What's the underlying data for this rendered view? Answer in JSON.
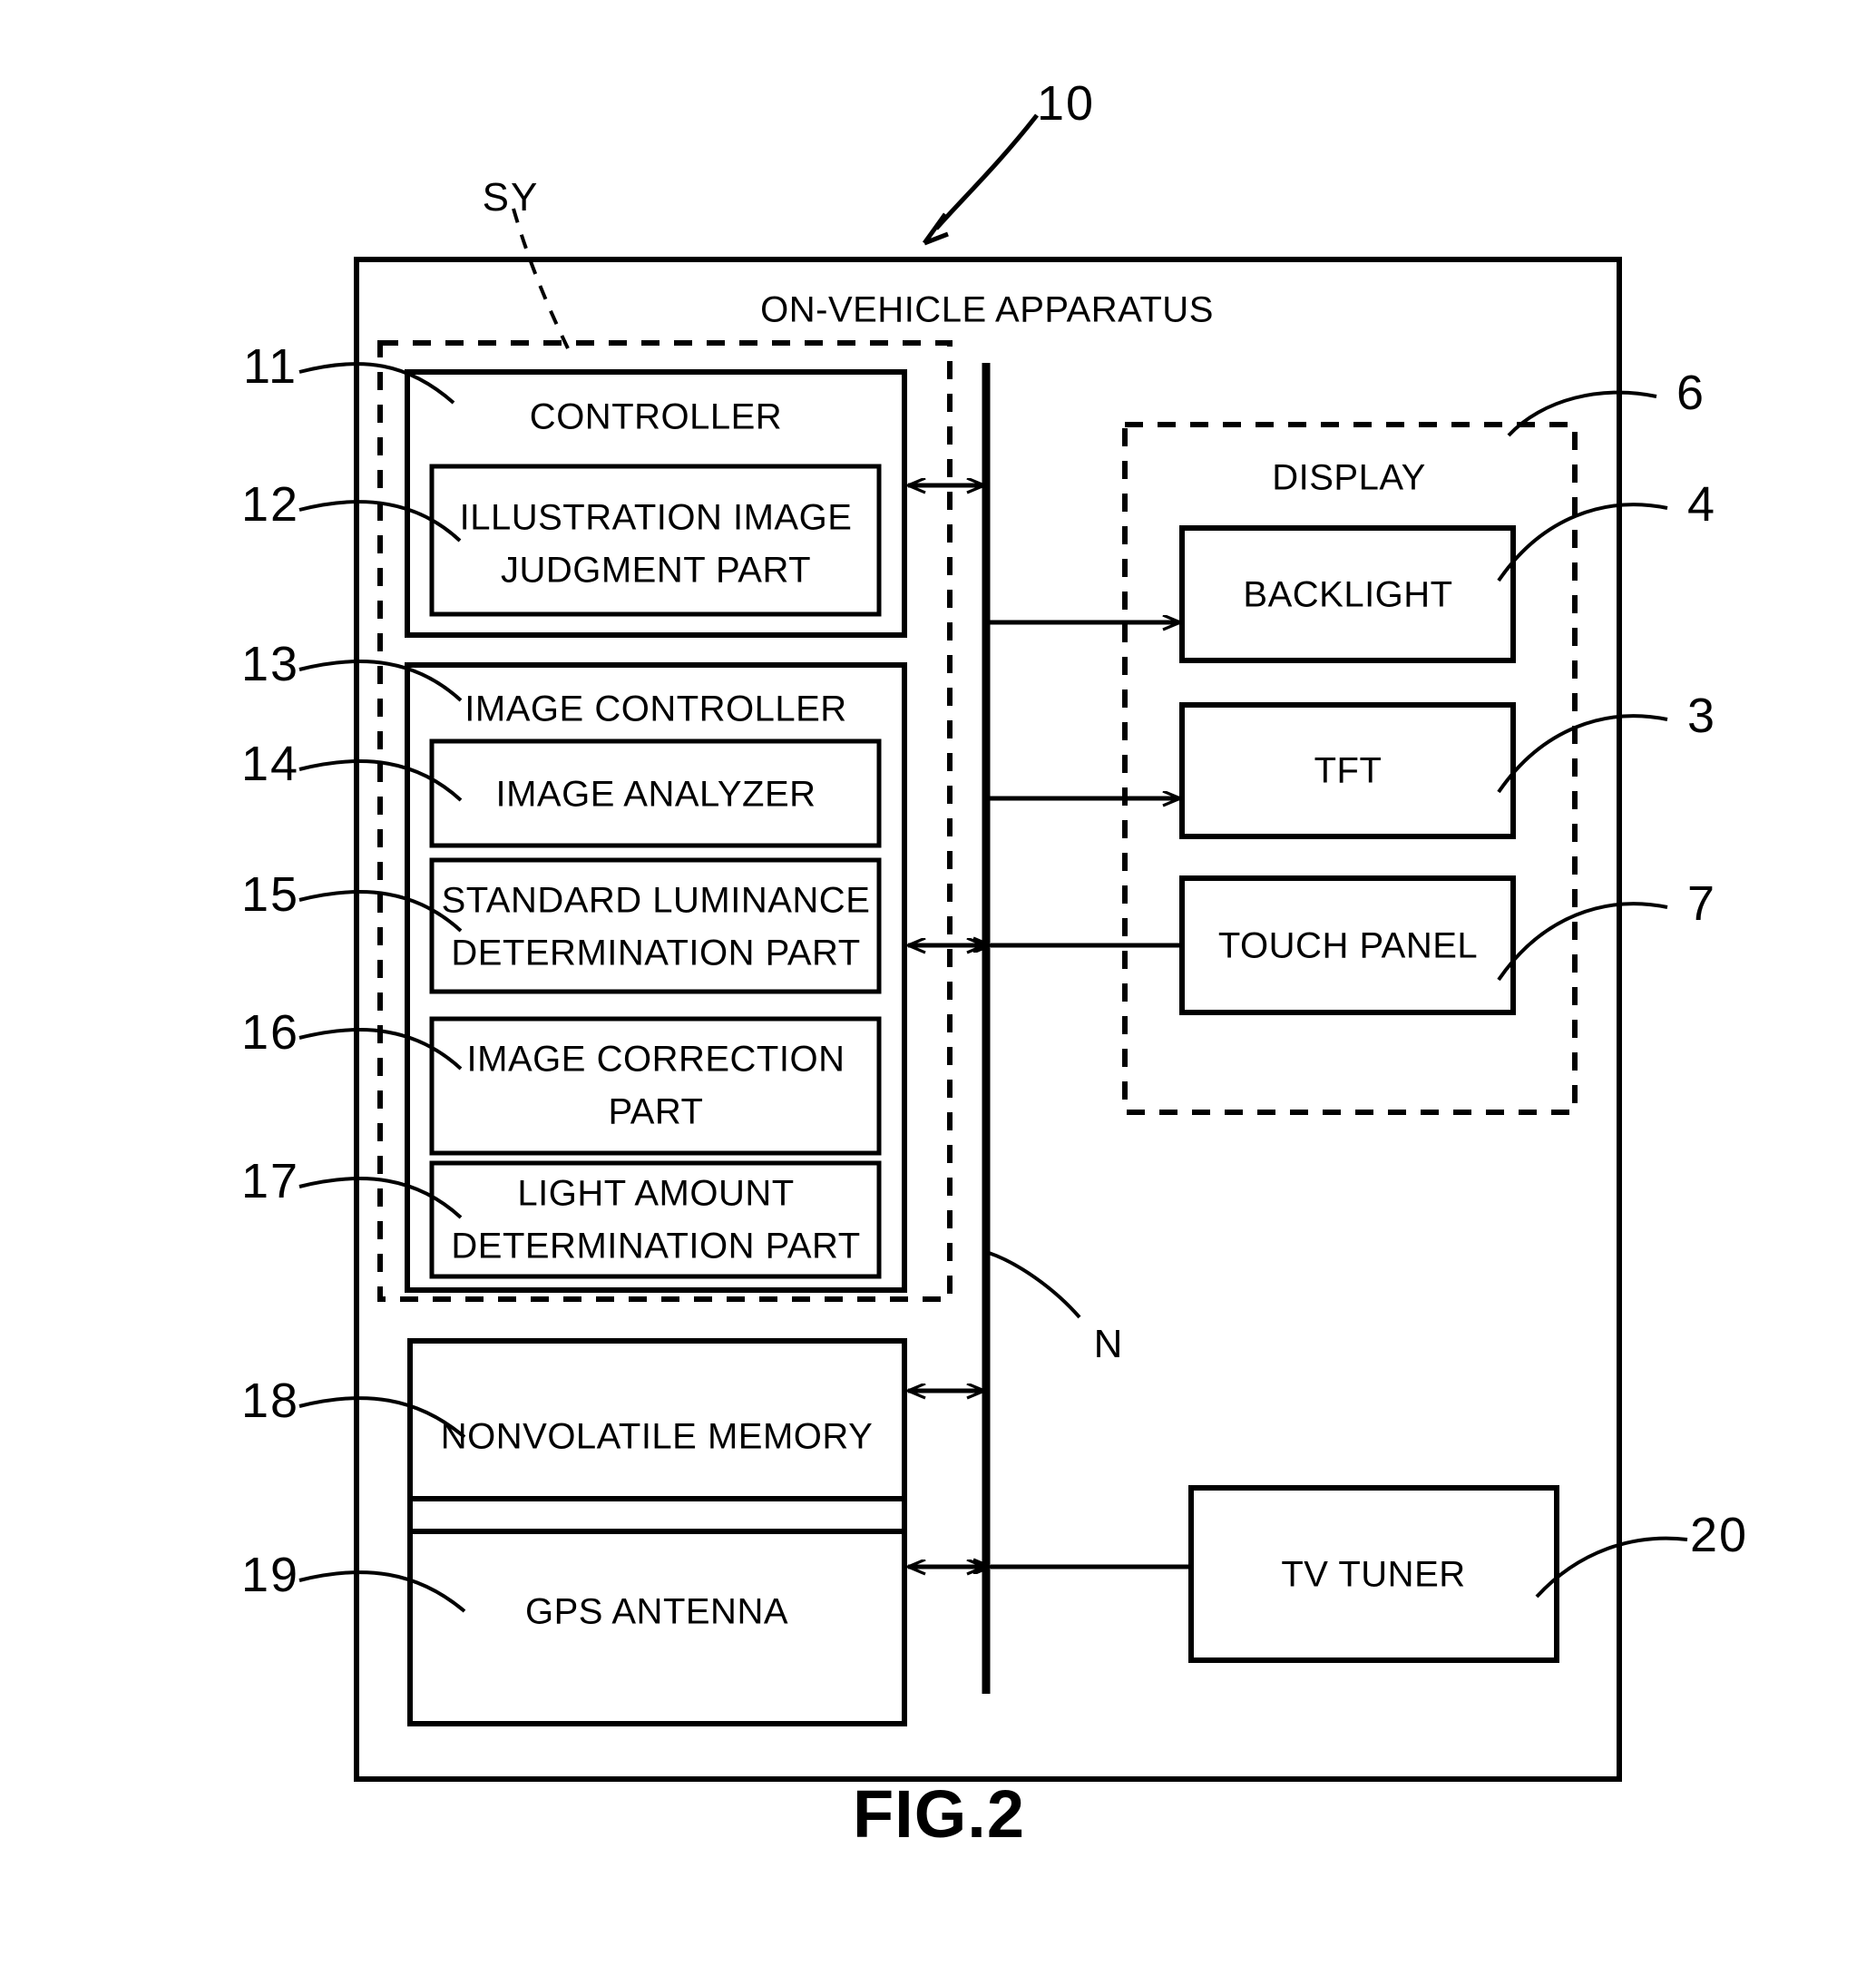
{
  "figure": {
    "caption": "FIG.2",
    "system_label": "SY",
    "network_label": "N",
    "apparatus_ref": "10"
  },
  "outer": {
    "title": "ON-VEHICLE APPARATUS",
    "ref": "10"
  },
  "controller": {
    "title": "CONTROLLER",
    "ref": "11",
    "child": {
      "title_line1": "ILLUSTRATION IMAGE",
      "title_line2": "JUDGMENT PART",
      "ref": "12"
    }
  },
  "image_controller": {
    "title": "IMAGE CONTROLLER",
    "ref": "13",
    "parts": [
      {
        "ref": "14",
        "line1": "IMAGE ANALYZER",
        "line2": ""
      },
      {
        "ref": "15",
        "line1": "STANDARD LUMINANCE",
        "line2": "DETERMINATION PART"
      },
      {
        "ref": "16",
        "line1": "IMAGE CORRECTION",
        "line2": "PART"
      },
      {
        "ref": "17",
        "line1": "LIGHT AMOUNT",
        "line2": "DETERMINATION PART"
      }
    ]
  },
  "memory": {
    "label": "NONVOLATILE MEMORY",
    "ref": "18"
  },
  "gps": {
    "label": "GPS ANTENNA",
    "ref": "19"
  },
  "display": {
    "title": "DISPLAY",
    "ref": "6",
    "items": [
      {
        "label": "BACKLIGHT",
        "ref": "4"
      },
      {
        "label": "TFT",
        "ref": "3"
      },
      {
        "label": "TOUCH PANEL",
        "ref": "7"
      }
    ]
  },
  "tv_tuner": {
    "label": "TV TUNER",
    "ref": "20"
  },
  "colors": {
    "stroke": "#000000",
    "background": "#ffffff"
  }
}
